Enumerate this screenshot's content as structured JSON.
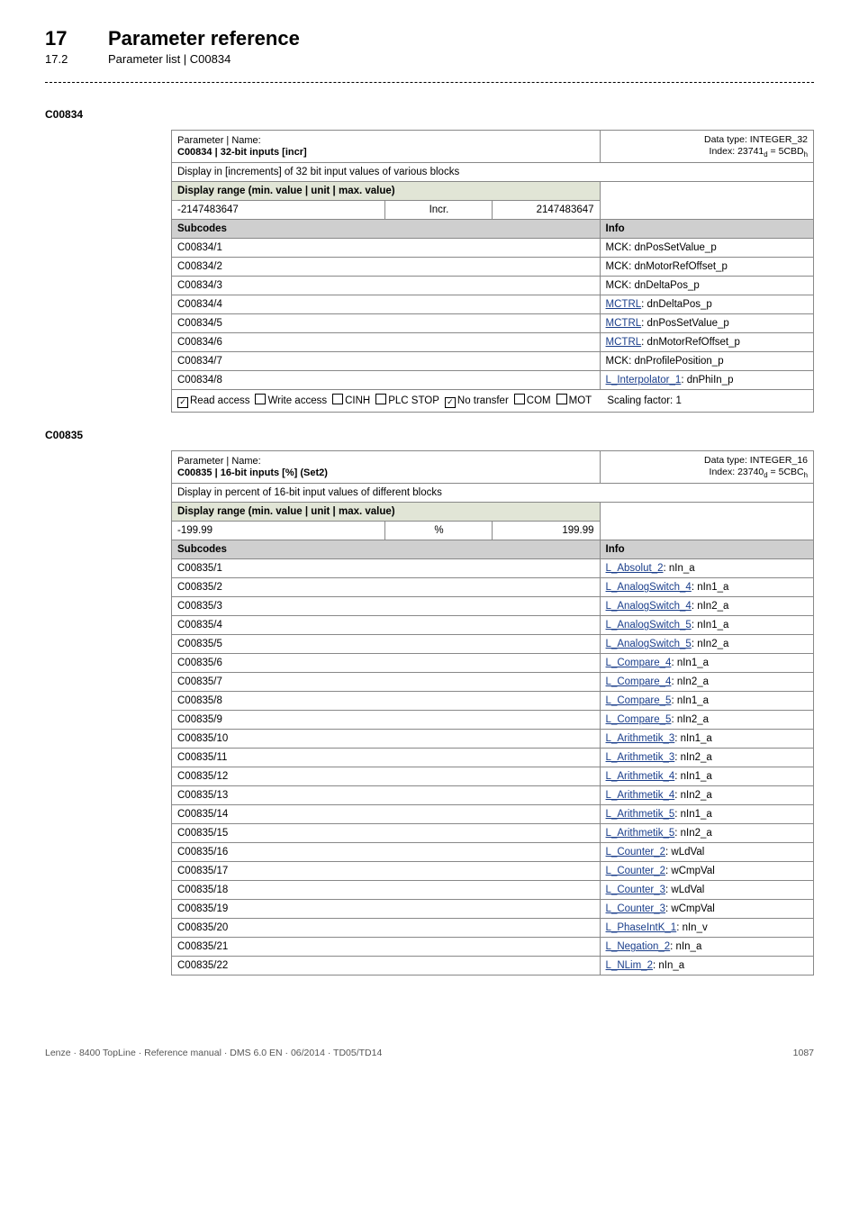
{
  "chapter": {
    "num": "17",
    "title": "Parameter reference",
    "sub_num": "17.2",
    "sub_title": "Parameter list | C00834"
  },
  "p1": {
    "code": "C00834",
    "hdr_name": "Parameter | Name:",
    "hdr_title": "C00834 | 32-bit inputs [incr]",
    "data_type": "Data type: INTEGER_32",
    "index": "Index: 23741",
    "index_sub": "d",
    "index_eq": " = 5CBD",
    "index_eq_sub": "h",
    "desc": "Display in [increments] of 32 bit input values of various blocks",
    "range_label": "Display range (min. value | unit | max. value)",
    "range": {
      "min": "-2147483647",
      "unit": "Incr.",
      "max": "2147483647"
    },
    "subcodes_label": "Subcodes",
    "info_label": "Info",
    "rows": [
      {
        "sc": "C00834/1",
        "info_plain": "MCK: dnPosSetValue_p"
      },
      {
        "sc": "C00834/2",
        "info_plain": "MCK: dnMotorRefOffset_p"
      },
      {
        "sc": "C00834/3",
        "info_plain": "MCK: dnDeltaPos_p"
      },
      {
        "sc": "C00834/4",
        "link": "MCTRL",
        "rest": ": dnDeltaPos_p"
      },
      {
        "sc": "C00834/5",
        "link": "MCTRL",
        "rest": ": dnPosSetValue_p"
      },
      {
        "sc": "C00834/6",
        "link": "MCTRL",
        "rest": ": dnMotorRefOffset_p"
      },
      {
        "sc": "C00834/7",
        "info_plain": "MCK: dnProfilePosition_p"
      },
      {
        "sc": "C00834/8",
        "link": "L_Interpolator_1",
        "rest": ": dnPhiIn_p"
      }
    ],
    "foot": {
      "items": [
        {
          "label": "Read access",
          "checked": true
        },
        {
          "label": "Write access",
          "checked": false
        },
        {
          "label": "CINH",
          "checked": false
        },
        {
          "label": "PLC STOP",
          "checked": false
        },
        {
          "label": "No transfer",
          "checked": true
        },
        {
          "label": "COM",
          "checked": false
        },
        {
          "label": "MOT",
          "checked": false
        }
      ],
      "scaling": "Scaling factor: 1"
    }
  },
  "p2": {
    "code": "C00835",
    "hdr_name": "Parameter | Name:",
    "hdr_title": "C00835 | 16-bit inputs [%] (Set2)",
    "data_type": "Data type: INTEGER_16",
    "index": "Index: 23740",
    "index_sub": "d",
    "index_eq": " = 5CBC",
    "index_eq_sub": "h",
    "desc": "Display in percent of 16-bit input values of different blocks",
    "range_label": "Display range (min. value | unit | max. value)",
    "range": {
      "min": "-199.99",
      "unit": "%",
      "max": "199.99"
    },
    "subcodes_label": "Subcodes",
    "info_label": "Info",
    "rows": [
      {
        "sc": "C00835/1",
        "link": "L_Absolut_2",
        "rest": ": nIn_a"
      },
      {
        "sc": "C00835/2",
        "link": "L_AnalogSwitch_4",
        "rest": ": nIn1_a"
      },
      {
        "sc": "C00835/3",
        "link": "L_AnalogSwitch_4",
        "rest": ": nIn2_a"
      },
      {
        "sc": "C00835/4",
        "link": "L_AnalogSwitch_5",
        "rest": ": nIn1_a"
      },
      {
        "sc": "C00835/5",
        "link": "L_AnalogSwitch_5",
        "rest": ": nIn2_a"
      },
      {
        "sc": "C00835/6",
        "link": "L_Compare_4",
        "rest": ": nIn1_a"
      },
      {
        "sc": "C00835/7",
        "link": "L_Compare_4",
        "rest": ": nIn2_a"
      },
      {
        "sc": "C00835/8",
        "link": "L_Compare_5",
        "rest": ": nIn1_a"
      },
      {
        "sc": "C00835/9",
        "link": "L_Compare_5",
        "rest": ": nIn2_a"
      },
      {
        "sc": "C00835/10",
        "link": "L_Arithmetik_3",
        "rest": ": nIn1_a"
      },
      {
        "sc": "C00835/11",
        "link": "L_Arithmetik_3",
        "rest": ": nIn2_a"
      },
      {
        "sc": "C00835/12",
        "link": "L_Arithmetik_4",
        "rest": ": nIn1_a"
      },
      {
        "sc": "C00835/13",
        "link": "L_Arithmetik_4",
        "rest": ": nIn2_a"
      },
      {
        "sc": "C00835/14",
        "link": "L_Arithmetik_5",
        "rest": ": nIn1_a"
      },
      {
        "sc": "C00835/15",
        "link": "L_Arithmetik_5",
        "rest": ": nIn2_a"
      },
      {
        "sc": "C00835/16",
        "link": "L_Counter_2",
        "rest": ": wLdVal"
      },
      {
        "sc": "C00835/17",
        "link": "L_Counter_2",
        "rest": ": wCmpVal"
      },
      {
        "sc": "C00835/18",
        "link": "L_Counter_3",
        "rest": ": wLdVal"
      },
      {
        "sc": "C00835/19",
        "link": "L_Counter_3",
        "rest": ": wCmpVal"
      },
      {
        "sc": "C00835/20",
        "link": "L_PhaseIntK_1",
        "rest": ": nIn_v"
      },
      {
        "sc": "C00835/21",
        "link": "L_Negation_2",
        "rest": ": nIn_a"
      },
      {
        "sc": "C00835/22",
        "link": "L_NLim_2",
        "rest": ": nIn_a"
      }
    ]
  },
  "footer": {
    "left": "Lenze · 8400 TopLine · Reference manual · DMS 6.0 EN · 06/2014 · TD05/TD14",
    "right": "1087"
  }
}
